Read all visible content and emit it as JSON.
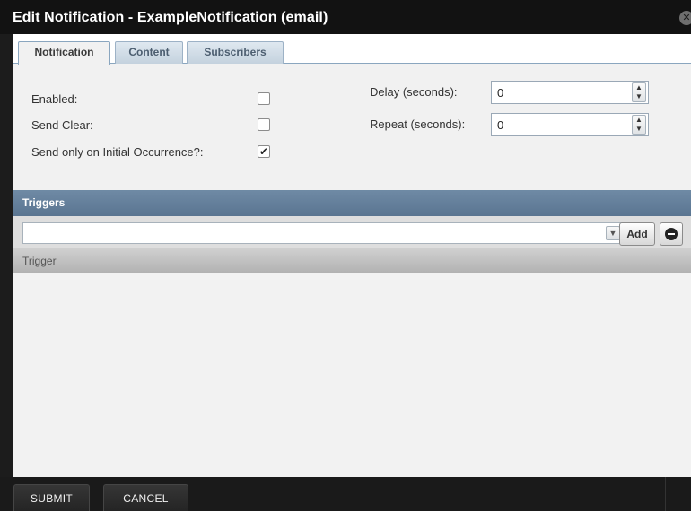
{
  "dialog": {
    "title": "Edit Notification - ExampleNotification (email)",
    "close_glyph": "✕"
  },
  "tabs": [
    {
      "label": "Notification",
      "active": true
    },
    {
      "label": "Content",
      "active": false
    },
    {
      "label": "Subscribers",
      "active": false
    }
  ],
  "form": {
    "enabled": {
      "label": "Enabled:",
      "checked": false,
      "mark": ""
    },
    "send_clear": {
      "label": "Send Clear:",
      "checked": false,
      "mark": ""
    },
    "initial_occurrence": {
      "label": "Send only on Initial Occurrence?:",
      "checked": true,
      "mark": "✔"
    },
    "delay": {
      "label": "Delay (seconds):",
      "value": "0"
    },
    "repeat": {
      "label": "Repeat (seconds):",
      "value": "0"
    }
  },
  "triggers": {
    "section_title": "Triggers",
    "selected": "",
    "add_label": "Add",
    "column_header": "Trigger",
    "rows": []
  },
  "footer": {
    "submit_label": "SUBMIT",
    "cancel_label": "CANCEL"
  },
  "icons": {
    "close": "close-icon",
    "spin_up": "chevron-up-icon",
    "spin_down": "chevron-down-icon",
    "combo_arrow": "chevron-down-icon",
    "remove": "minus-circle-icon",
    "check": "checkmark-icon"
  },
  "colors": {
    "titlebar_bg": "#121212",
    "section_header_bg": "#5f7a96",
    "panel_bg": "#f1f1f1",
    "footer_bg": "#1a1a1a"
  }
}
